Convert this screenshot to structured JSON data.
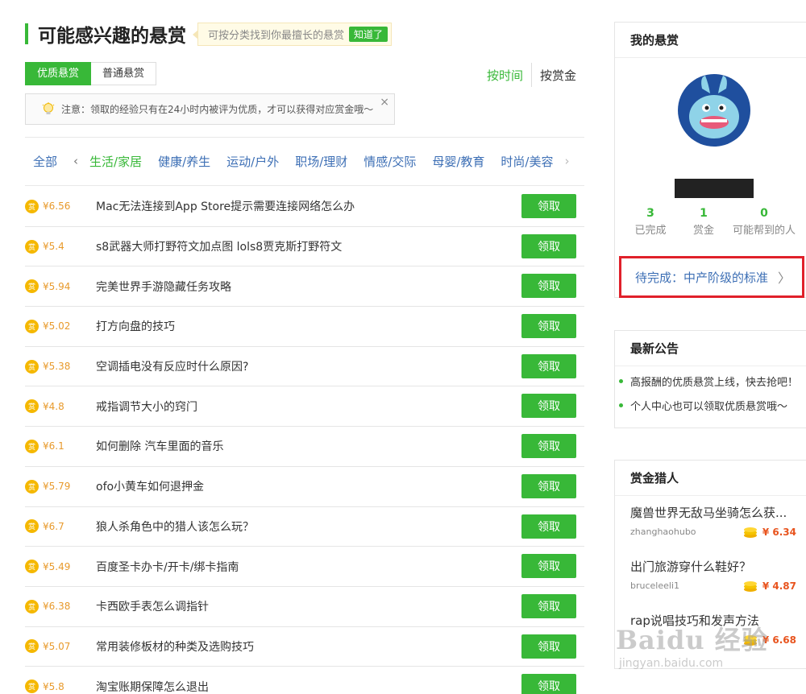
{
  "header": {
    "title": "可能感兴趣的悬赏",
    "tip": "可按分类找到你最擅长的悬赏",
    "tip_button": "知道了"
  },
  "tabs": [
    {
      "label": "优质悬赏",
      "active": true
    },
    {
      "label": "普通悬赏",
      "active": false
    }
  ],
  "sort": {
    "by_time": "按时间",
    "by_reward": "按赏金"
  },
  "notice": {
    "text": "注意：领取的经验只有在24小时内被评为优质，才可以获得对应赏金哦～",
    "close": "×"
  },
  "categories": {
    "all": "全部",
    "prev_arrow": "‹",
    "next_arrow": "›",
    "items": [
      "生活/家居",
      "健康/养生",
      "运动/户外",
      "职场/理财",
      "情感/交际",
      "母婴/教育",
      "时尚/美容"
    ]
  },
  "list": {
    "coin_char": "赏",
    "claim_label": "领取",
    "items": [
      {
        "reward": "¥6.56",
        "question": "Mac无法连接到App Store提示需要连接网络怎么办"
      },
      {
        "reward": "¥5.4",
        "question": "s8武器大师打野符文加点图 lols8贾克斯打野符文"
      },
      {
        "reward": "¥5.94",
        "question": "完美世界手游隐藏任务攻略"
      },
      {
        "reward": "¥5.02",
        "question": "打方向盘的技巧"
      },
      {
        "reward": "¥5.38",
        "question": "空调插电没有反应时什么原因?"
      },
      {
        "reward": "¥4.8",
        "question": "戒指调节大小的窍门"
      },
      {
        "reward": "¥6.1",
        "question": "如何删除 汽车里面的音乐"
      },
      {
        "reward": "¥5.79",
        "question": "ofo小黄车如何退押金"
      },
      {
        "reward": "¥6.7",
        "question": "狼人杀角色中的猎人该怎么玩？"
      },
      {
        "reward": "¥5.49",
        "question": "百度圣卡办卡/开卡/绑卡指南"
      },
      {
        "reward": "¥6.38",
        "question": "卡西欧手表怎么调指针"
      },
      {
        "reward": "¥5.07",
        "question": "常用装修板材的种类及选购技巧"
      },
      {
        "reward": "¥5.8",
        "question": "淘宝账期保障怎么退出"
      }
    ]
  },
  "my_bounty": {
    "title": "我的悬赏",
    "stats": [
      {
        "value": "3",
        "label": "已完成"
      },
      {
        "value": "1",
        "label": "赏金"
      },
      {
        "value": "0",
        "label": "可能帮到的人"
      }
    ],
    "pending": "待完成：中产阶级的标准",
    "pending_arrow": "〉"
  },
  "announcements": {
    "title": "最新公告",
    "items": [
      "高报酬的优质悬赏上线，快去抢吧！",
      "个人中心也可以领取优质悬赏哦～"
    ]
  },
  "hunters": {
    "title": "赏金猎人",
    "items": [
      {
        "question": "魔兽世界无敌马坐骑怎么获...",
        "user": "zhanghaohubo",
        "reward": "¥ 6.34"
      },
      {
        "question": "出门旅游穿什么鞋好？",
        "user": "bruceleeli1",
        "reward": "¥ 4.87"
      },
      {
        "question": "rap说唱技巧和发声方法",
        "user": "",
        "reward": "¥ 6.68"
      }
    ]
  },
  "watermark": {
    "main": "Baidu 经验",
    "sub": "jingyan.baidu.com"
  },
  "colors": {
    "accent": "#38b838",
    "link": "#3d6fb5",
    "reward": "#e89a2c",
    "highlight": "#e0202a"
  }
}
